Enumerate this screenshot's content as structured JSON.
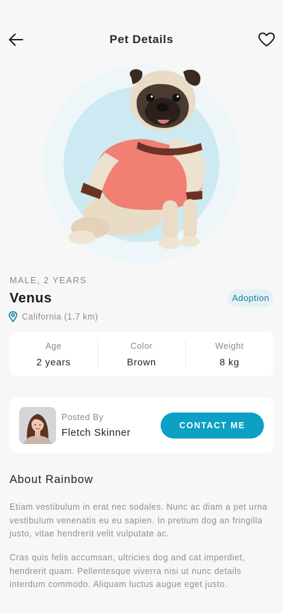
{
  "header": {
    "title": "Pet Details",
    "back_icon": "arrow-left-icon",
    "favorite_icon": "heart-icon"
  },
  "pet": {
    "meta": "MALE, 2 YEARS",
    "name": "Venus",
    "tag": "Adoption",
    "location": "California (1.7 km)",
    "image": "pug-in-pink-shirt"
  },
  "stats": [
    {
      "label": "Age",
      "value": "2 years"
    },
    {
      "label": "Color",
      "value": "Brown"
    },
    {
      "label": "Weight",
      "value": "8 kg"
    }
  ],
  "owner": {
    "posted_by_label": "Posted By",
    "name": "Fletch Skinner",
    "contact_label": "CONTACT ME"
  },
  "about": {
    "title": "About Rainbow",
    "paragraphs": [
      "Etiam vestibulum in erat nec sodales. Nunc ac diam a pet urna vestibulum venenatis eu eu sapien. In pretium dog an fringilla justo, vitae hendrerit velit vulputate ac.",
      "Cras quis felis accumsan, ultricies dog and cat imperdiet, hendrerit quam. Pellentesque viverra nisi ut nunc details interdum commodo. Aliquam luctus augue eget justo."
    ]
  },
  "colors": {
    "accent": "#0BA0C4",
    "tag_bg": "#E4F2F6",
    "tag_text": "#1A7E9B",
    "hero_circle": "#CDEAF3"
  }
}
